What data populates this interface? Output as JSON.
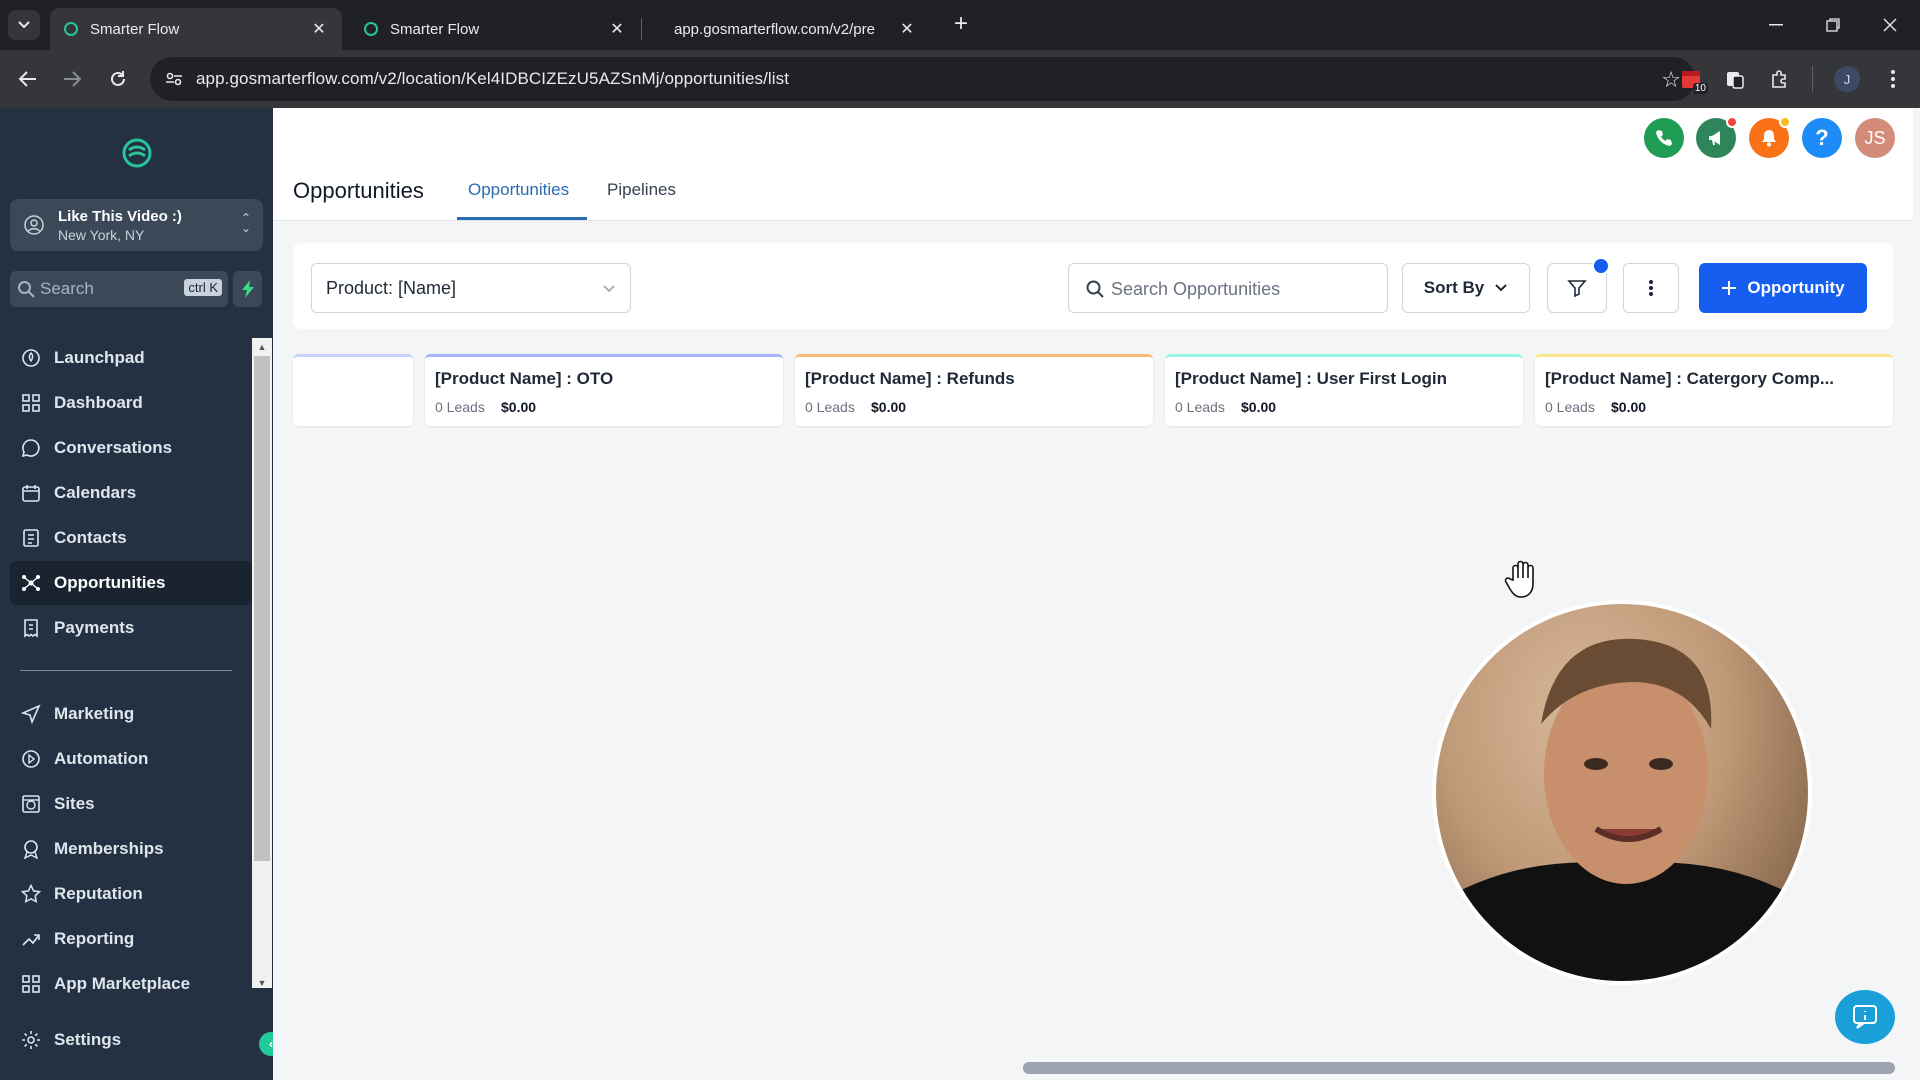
{
  "browser": {
    "tabs": [
      {
        "title": "Smarter Flow",
        "active": true
      },
      {
        "title": "Smarter Flow",
        "active": false
      },
      {
        "title": "app.gosmarterflow.com/v2/pre",
        "active": false
      }
    ],
    "url": "app.gosmarterflow.com/v2/location/Kel4IDBCIZEzU5AZSnMj/opportunities/list",
    "extension_badge": "10",
    "profile_initial": "J"
  },
  "sidebar": {
    "account": {
      "name": "Like This Video :)",
      "location": "New York, NY"
    },
    "search": {
      "placeholder": "Search",
      "shortcut": "ctrl K"
    },
    "nav": [
      {
        "label": "Launchpad",
        "icon": "rocket-icon"
      },
      {
        "label": "Dashboard",
        "icon": "grid-icon"
      },
      {
        "label": "Conversations",
        "icon": "chat-icon"
      },
      {
        "label": "Calendars",
        "icon": "calendar-icon"
      },
      {
        "label": "Contacts",
        "icon": "contacts-icon"
      },
      {
        "label": "Opportunities",
        "icon": "network-icon",
        "active": true
      },
      {
        "label": "Payments",
        "icon": "receipt-icon"
      }
    ],
    "nav2": [
      {
        "label": "Marketing",
        "icon": "send-icon"
      },
      {
        "label": "Automation",
        "icon": "automation-icon"
      },
      {
        "label": "Sites",
        "icon": "globe-icon"
      },
      {
        "label": "Memberships",
        "icon": "badge-icon"
      },
      {
        "label": "Reputation",
        "icon": "star-icon"
      },
      {
        "label": "Reporting",
        "icon": "trend-icon"
      },
      {
        "label": "App Marketplace",
        "icon": "apps-icon"
      }
    ],
    "settings_label": "Settings"
  },
  "header": {
    "title": "Opportunities",
    "tabs": [
      {
        "label": "Opportunities",
        "active": true
      },
      {
        "label": "Pipelines",
        "active": false
      }
    ],
    "user_initials": "JS",
    "help_label": "?"
  },
  "filters": {
    "pipeline_value": "Product: [Name]",
    "search_placeholder": "Search Opportunities",
    "sort_label": "Sort By",
    "add_label": "Opportunity"
  },
  "stages": [
    {
      "name": "",
      "leads": "",
      "value": "",
      "color": "#c7d2fe"
    },
    {
      "name": "[Product Name] : OTO",
      "leads": "0 Leads",
      "value": "$0.00",
      "color": "#a5b4fc"
    },
    {
      "name": "[Product Name] : Refunds",
      "leads": "0 Leads",
      "value": "$0.00",
      "color": "#fdba74"
    },
    {
      "name": "[Product Name] : User First Login",
      "leads": "0 Leads",
      "value": "$0.00",
      "color": "#99f6e4"
    },
    {
      "name": "[Product Name] : Catergory Comp...",
      "leads": "0 Leads",
      "value": "$0.00",
      "color": "#fde68a"
    }
  ],
  "colors": {
    "sidebar_bg": "#233142",
    "accent": "#155eef",
    "phone": "#1f9d55",
    "megaphone": "#2f855a",
    "bell": "#f97316",
    "help": "#1d8cf8",
    "avatar": "#d38b7a"
  }
}
